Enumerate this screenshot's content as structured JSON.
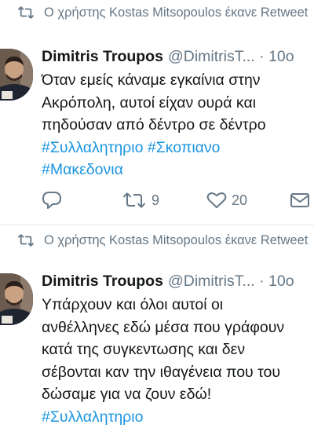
{
  "colors": {
    "link": "#1b95e0",
    "muted": "#657786",
    "text": "#14171a"
  },
  "tweets": [
    {
      "retweet_header": "Ο χρήστης Kostas Mitsopoulos έκανε Retweet",
      "author": {
        "name": "Dimitris Troupos",
        "handle": "@DimitrisT...",
        "separator": "·",
        "time": "10ο"
      },
      "text_lines": [
        "Όταν εμείς κάναμε εγκαίνια στην",
        "Ακρόπολη, αυτοί  είχαν ουρά και",
        "πηδούσαν από δέντρο σε δέντρο"
      ],
      "hashtag_lines": [
        [
          "#Συλλαλητηριο",
          "#Σκοπιανο"
        ],
        [
          "#Μακεδονια"
        ]
      ],
      "actions": {
        "reply_icon": "reply-icon",
        "retweet_count": "9",
        "like_count": "20",
        "dm_icon": "envelope-icon"
      }
    },
    {
      "retweet_header": "Ο χρήστης Kostas Mitsopoulos έκανε Retweet",
      "author": {
        "name": "Dimitris Troupos",
        "handle": "@DimitrisT...",
        "separator": "·",
        "time": "10ο"
      },
      "text_lines": [
        "Υπάρχουν και όλοι αυτοί οι",
        "ανθέλληνες εδώ μέσα που γράφουν",
        "κατά της συγκεντωσης και δεν",
        "σέβονται καν την ιθαγένεια που του",
        "δώσαμε για να ζουν εδώ!"
      ],
      "hashtag_lines": [
        [
          "#Συλλαλητηριο"
        ]
      ]
    }
  ]
}
